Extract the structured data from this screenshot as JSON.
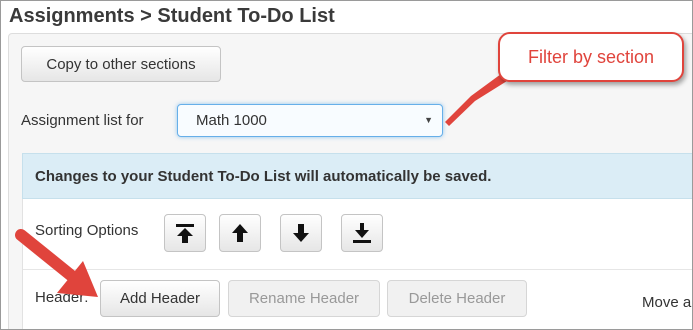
{
  "breadcrumb": "Assignments > Student To-Do List",
  "copy_button": "Copy to other sections",
  "assignment_list": {
    "label": "Assignment list for",
    "selected": "Math 1000"
  },
  "info_message": "Changes to your Student To-Do List will automatically be saved.",
  "sorting": {
    "label": "Sorting Options",
    "buttons": [
      "move-to-top-icon",
      "move-up-icon",
      "move-down-icon",
      "move-to-bottom-icon"
    ]
  },
  "header": {
    "label": "Header:",
    "add": "Add Header",
    "rename": "Rename Header",
    "delete": "Delete Header"
  },
  "move_label": "Move a",
  "annotation": {
    "callout_text": "Filter by section",
    "accent_color": "#e0443c"
  }
}
